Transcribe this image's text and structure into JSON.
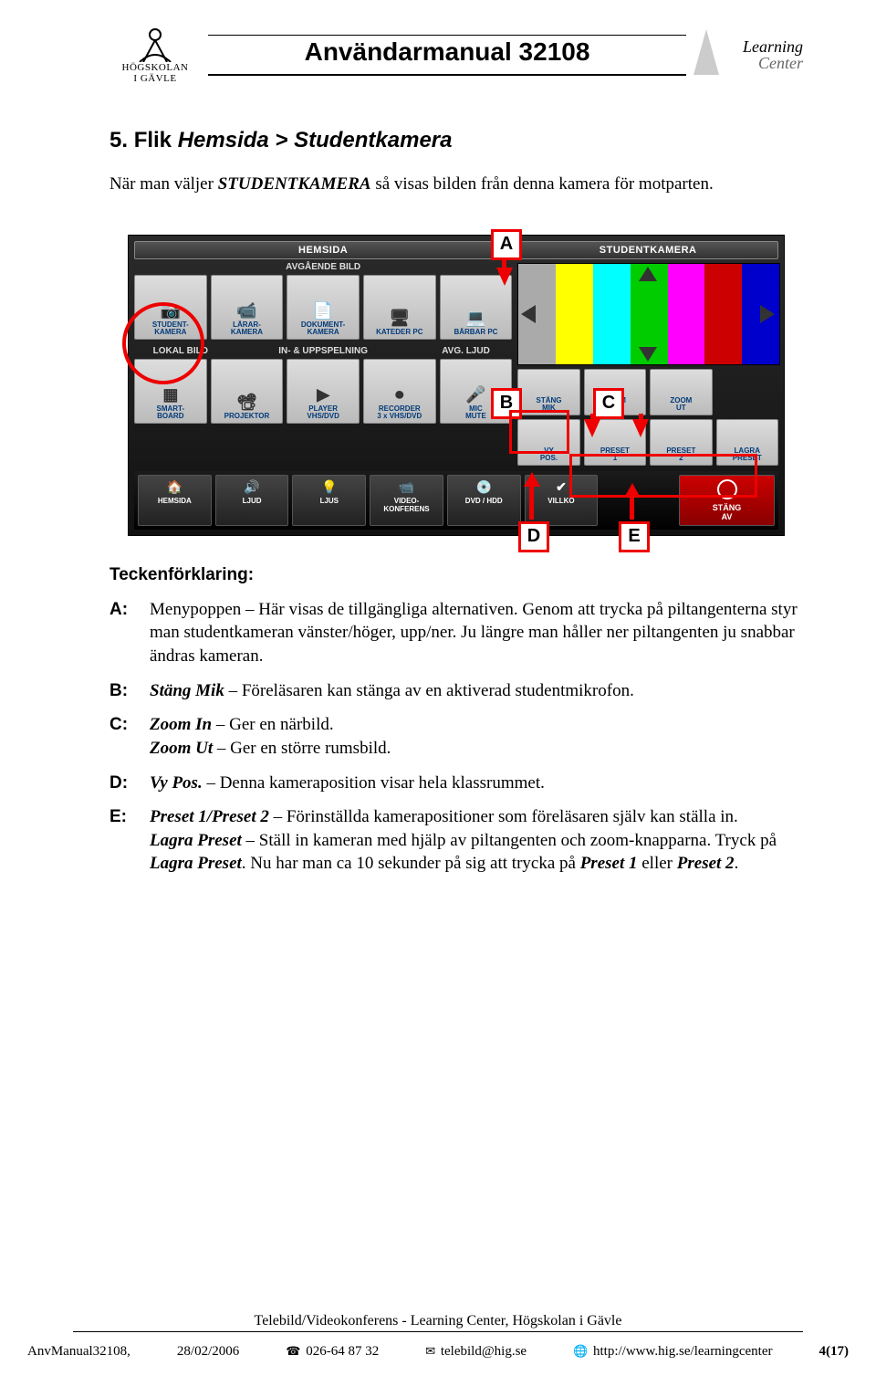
{
  "header": {
    "left_logo_line1": "HÖGSKOLAN",
    "left_logo_line2": "I GÄVLE",
    "title": "Användarmanual 32108",
    "right_logo_line1": "Learning",
    "right_logo_line2": "Center"
  },
  "section": {
    "number": "5.",
    "title_prefix": "Flik ",
    "title_italic": "Hemsida > Studentkamera",
    "intro_pre": "När man väljer ",
    "intro_em": "STUDENTKAMERA",
    "intro_post": " så visas bilden från denna kamera för motparten."
  },
  "annot": {
    "A": "A",
    "B": "B",
    "C": "C",
    "D": "D",
    "E": "E"
  },
  "shot": {
    "hemsida": "HEMSIDA",
    "studentkamera": "STUDENTKAMERA",
    "avgaende": "AVGÅENDE BILD",
    "lokal": "LOKAL BILD",
    "inupp": "IN- & UPPSPELNING",
    "avgljud": "AVG. LJUD",
    "btns_top": [
      "STUDENT-\nKAMERA",
      "LÄRAR-\nKAMERA",
      "DOKUMENT-\nKAMERA",
      "KATEDER PC",
      "BÄRBAR PC"
    ],
    "btns_mid": [
      "SMART-\nBOARD",
      "PROJEKTOR",
      "PLAYER\nVHS/DVD",
      "RECORDER\n3 x VHS/DVD",
      "MIC\nMUTE"
    ],
    "btns_right1": [
      "STÄNG\nMIK",
      "ZOOM\nIN",
      "ZOOM\nUT",
      ""
    ],
    "btns_right2": [
      "VY\nPOS.",
      "PRESET\n1",
      "PRESET\n2",
      "LAGRA\nPRESET"
    ],
    "nav": [
      "HEMSIDA",
      "LJUD",
      "LJUS",
      "VIDEO-\nKONFERENS",
      "DVD / HDD",
      "VILLKO"
    ],
    "nav_off": "STÄNG\nAV"
  },
  "legend": {
    "title": "Teckenförklaring:",
    "items": [
      {
        "k": "A:",
        "text": "Menypoppen – Här visas de tillgängliga alternativen. Genom att trycka på piltangenterna styr man studentkameran vänster/höger, upp/ner. Ju längre man håller ner piltangenten ju snabbar ändras kameran."
      },
      {
        "k": "B:",
        "html": "<span class='b'>Stäng Mik</span> – Föreläsaren kan stänga av en aktiverad studentmikrofon."
      },
      {
        "k": "C:",
        "html": "<span class='b'>Zoom In</span> – Ger en närbild.<br><span class='b'>Zoom Ut</span> – Ger en större rumsbild."
      },
      {
        "k": "D:",
        "html": "<span class='b'>Vy Pos.</span> – Denna kameraposition visar hela klassrummet."
      },
      {
        "k": "E:",
        "html": "<span class='b'>Preset 1/Preset 2</span> – Förinställda kamerapositioner som föreläsaren själv kan ställa in.<br><span class='b'>Lagra Preset</span> – Ställ in kameran med hjälp av piltangenten och zoom-knapparna. Tryck på <span class='b'>Lagra Preset</span>. Nu har man ca 10 sekunder på sig att trycka på <span class='b'>Preset 1</span> eller <span class='b'>Preset 2</span>."
      }
    ]
  },
  "footer": {
    "center": "Telebild/Videokonferens - Learning Center, Högskolan i Gävle",
    "file": "AnvManual32108,",
    "date": "28/02/2006",
    "phone": "026-64 87 32",
    "email": "telebild@hig.se",
    "url": "http://www.hig.se/learningcenter",
    "page": "4(17)"
  }
}
